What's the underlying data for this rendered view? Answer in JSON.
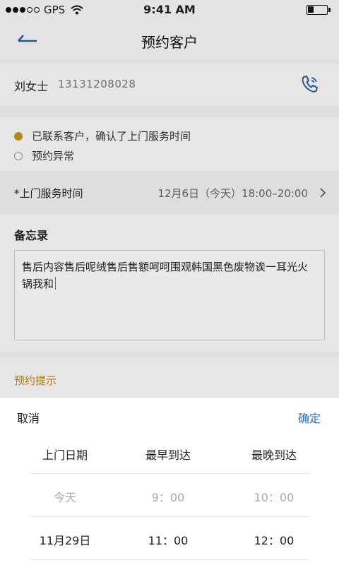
{
  "status_bar": {
    "carrier": "GPS",
    "time": "9:41 AM"
  },
  "nav": {
    "title": "预约客户"
  },
  "customer": {
    "name": "刘女士",
    "phone": "13131208028"
  },
  "status_options": [
    {
      "label": "已联系客户，确认了上门服务时间",
      "selected": true
    },
    {
      "label": "预约异常",
      "selected": false
    }
  ],
  "service_time": {
    "label": "*上门服务时间",
    "value": "12月6日（今天）18:00–20:00"
  },
  "memo": {
    "title": "备忘录",
    "text": "售后内容售后呢绒售后售额呵呵围观韩国黑色废物诶一耳光火锅我和"
  },
  "reminder": {
    "title": "预约提示"
  },
  "picker": {
    "cancel_label": "取消",
    "confirm_label": "确定",
    "columns": [
      "上门日期",
      "最早到达",
      "最晚到达"
    ],
    "rows": [
      [
        "今天",
        "9：00",
        "10：00"
      ],
      [
        "11月29日",
        "11：00",
        "12：00"
      ]
    ]
  },
  "colors": {
    "accent_gold": "#c5921d",
    "link_blue": "#2a6fb8"
  }
}
